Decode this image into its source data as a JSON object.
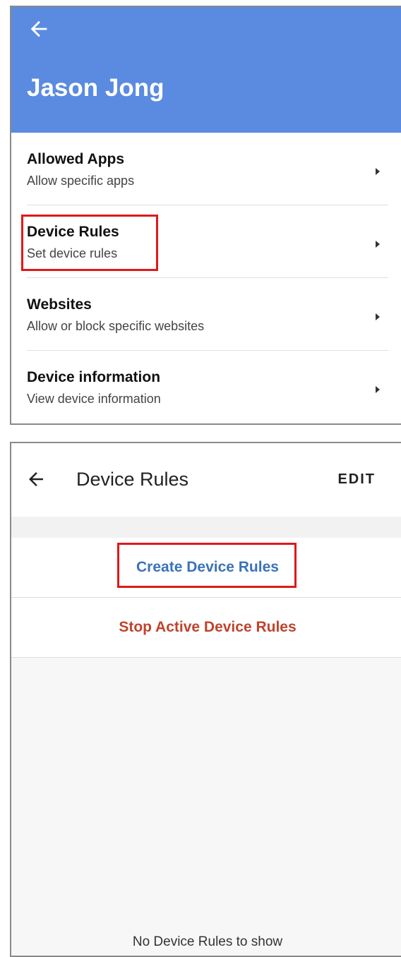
{
  "panel1": {
    "title": "Jason Jong",
    "header_color": "#5b8be0",
    "items": [
      {
        "title": "Allowed Apps",
        "subtitle": "Allow specific apps"
      },
      {
        "title": "Device Rules",
        "subtitle": "Set device rules"
      },
      {
        "title": "Websites",
        "subtitle": "Allow or block specific websites"
      },
      {
        "title": "Device information",
        "subtitle": "View device information"
      }
    ]
  },
  "panel2": {
    "title": "Device Rules",
    "edit_label": "EDIT",
    "create_label": "Create Device Rules",
    "stop_label": "Stop Active Device Rules",
    "empty_text": "No Device Rules to show"
  },
  "colors": {
    "highlight": "#e01919",
    "create": "#3a73b8",
    "stop": "#c0432d"
  }
}
